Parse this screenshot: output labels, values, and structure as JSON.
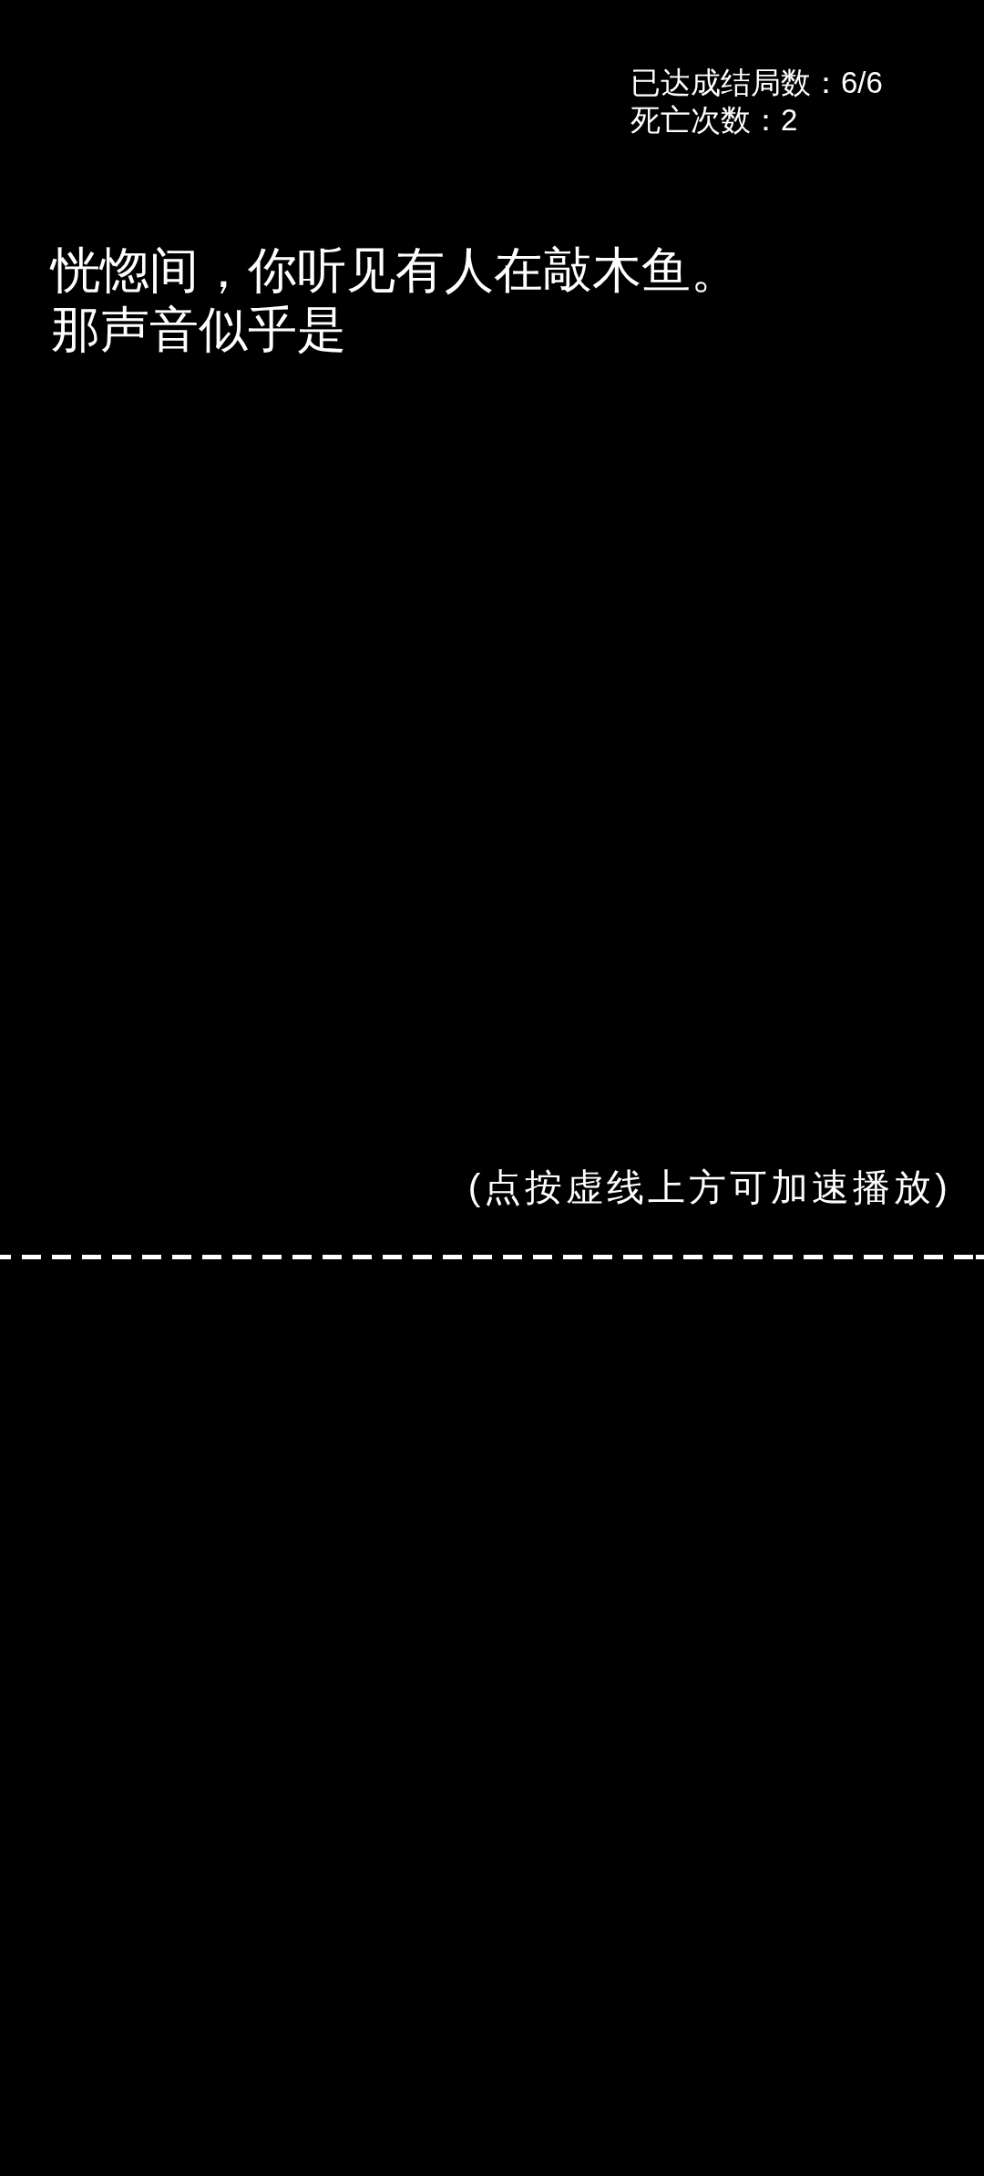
{
  "hud": {
    "endings_reached": "已达成结局数：6/6",
    "death_count": "死亡次数：2"
  },
  "story": {
    "text": "恍惚间，你听见有人在敲木鱼。那声音似乎是"
  },
  "speedup_hint": "(点按虚线上方可加速播放)"
}
